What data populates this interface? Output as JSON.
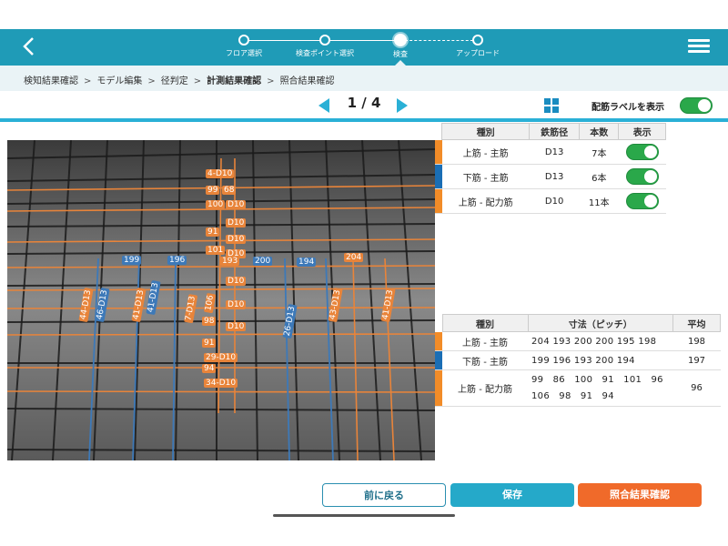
{
  "header": {
    "back_icon": "chevron-left-icon",
    "menu_icon": "hamburger-menu-icon",
    "steps": [
      {
        "label": "フロア選択",
        "state": "done"
      },
      {
        "label": "検査ポイント選択",
        "state": "done"
      },
      {
        "label": "検査",
        "state": "active"
      },
      {
        "label": "アップロード",
        "state": "todo"
      }
    ]
  },
  "breadcrumb": [
    {
      "label": "検知結果確認"
    },
    {
      "label": "モデル編集"
    },
    {
      "label": "径判定"
    },
    {
      "label": "計測結果確認",
      "current": true
    },
    {
      "label": "照合結果確認"
    }
  ],
  "pager": {
    "text": "1 / 4"
  },
  "label_toggle": {
    "label": "配筋ラベルを表示",
    "on": true
  },
  "rebar_table": {
    "headers": [
      "種別",
      "鉄筋径",
      "本数",
      "表示"
    ],
    "rows": [
      {
        "type": "上筋 - 主筋",
        "diameter": "D13",
        "count": "7本",
        "color": "#f28c28",
        "show": true
      },
      {
        "type": "下筋 - 主筋",
        "diameter": "D13",
        "count": "6本",
        "color": "#1a6eb5",
        "show": true
      },
      {
        "type": "上筋 - 配力筋",
        "diameter": "D10",
        "count": "11本",
        "color": "#f28c28",
        "show": true
      }
    ]
  },
  "pitch_table": {
    "headers": [
      "種別",
      "寸法（ピッチ）",
      "平均"
    ],
    "rows": [
      {
        "type": "上筋 - 主筋",
        "dims": "204 193 200 200 195 198",
        "avg": "198",
        "color": "#f28c28"
      },
      {
        "type": "下筋 - 主筋",
        "dims": "199 196 193 200 194",
        "avg": "197",
        "color": "#1a6eb5"
      },
      {
        "type": "上筋 - 配力筋",
        "dims": "99　86　100　91　101　96",
        "dims2": "106　98　91　94",
        "avg": "96",
        "color": "#f28c28"
      }
    ]
  },
  "photo_labels": {
    "top_labels": [
      "4-D10",
      "99",
      "68",
      "100",
      "D10",
      "D10",
      "91",
      "D10",
      "D10",
      "101"
    ],
    "horizontal_values": [
      "199",
      "196",
      "200",
      "194",
      "204",
      "193"
    ],
    "vertical_labels": [
      "44-D13",
      "46-D13",
      "41-D13",
      "41-D13",
      "7-D13",
      "106",
      "D10",
      "D10",
      "26-D13",
      "43-D13",
      "41-D13",
      "98",
      "D10"
    ],
    "bottom_labels": [
      "91",
      "29-D10",
      "94",
      "34-D10"
    ]
  },
  "buttons": {
    "back": "前に戻る",
    "save": "保存",
    "check": "照合結果確認"
  }
}
